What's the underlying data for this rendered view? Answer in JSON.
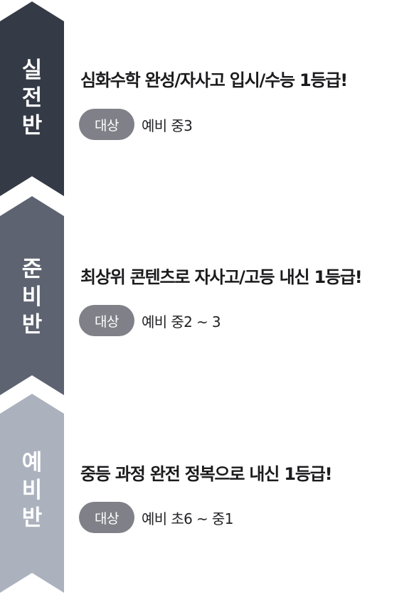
{
  "stages": [
    {
      "label_chars": [
        "실",
        "전",
        "반"
      ],
      "headline": "심화수학 완성/자사고 입시/수능 1등급!",
      "target_label": "대상",
      "target_value": "예비 중3",
      "color": "#353b46"
    },
    {
      "label_chars": [
        "준",
        "비",
        "반"
      ],
      "headline": "최상위 콘텐츠로 자사고/고등 내신 1등급!",
      "target_label": "대상",
      "target_value": "예비 중2 ~ 3",
      "color": "#5d6370"
    },
    {
      "label_chars": [
        "예",
        "비",
        "반"
      ],
      "headline": "중등 과정 완전 정복으로 내신 1등급!",
      "target_label": "대상",
      "target_value": "예비 초6 ~ 중1",
      "color": "#abb2be"
    }
  ]
}
